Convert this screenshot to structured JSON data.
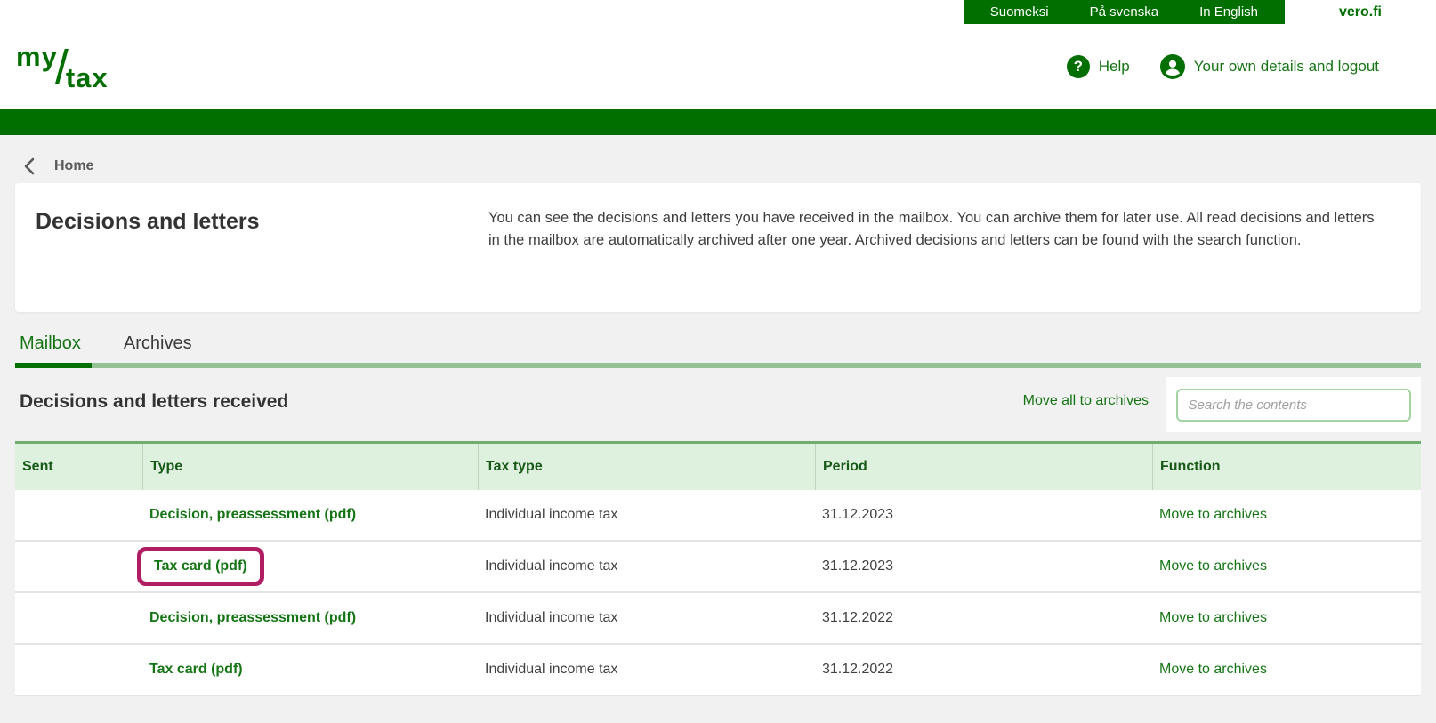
{
  "topbar": {
    "languages": [
      "Suomeksi",
      "På svenska",
      "In English"
    ],
    "site_link": "vero.fi"
  },
  "header": {
    "logo_my": "my",
    "logo_slash": "/",
    "logo_tax": "tax",
    "help_label": "Help",
    "help_glyph": "?",
    "account_label": "Your own details and logout"
  },
  "breadcrumb": {
    "back_label": "Home"
  },
  "intro": {
    "title": "Decisions and letters",
    "description": "You can see the decisions and letters you have received in the mailbox. You can archive them for later use. All read decisions and letters in the mailbox are automatically archived after one year. Archived decisions and letters can be found with the search function."
  },
  "tabs": [
    {
      "label": "Mailbox",
      "active": true
    },
    {
      "label": "Archives",
      "active": false
    }
  ],
  "received": {
    "title": "Decisions and letters received",
    "move_all_label": "Move all to archives",
    "search_placeholder": "Search the contents"
  },
  "table": {
    "columns": [
      "Sent",
      "Type",
      "Tax type",
      "Period",
      "Function"
    ],
    "rows": [
      {
        "sent": "",
        "type": "Decision, preassessment (pdf)",
        "tax_type": "Individual income tax",
        "period": "31.12.2023",
        "function": "Move to archives",
        "highlighted": false
      },
      {
        "sent": "",
        "type": "Tax card (pdf)",
        "tax_type": "Individual income tax",
        "period": "31.12.2023",
        "function": "Move to archives",
        "highlighted": true
      },
      {
        "sent": "",
        "type": "Decision, preassessment (pdf)",
        "tax_type": "Individual income tax",
        "period": "31.12.2022",
        "function": "Move to archives",
        "highlighted": false
      },
      {
        "sent": "",
        "type": "Tax card (pdf)",
        "tax_type": "Individual income tax",
        "period": "31.12.2022",
        "function": "Move to archives",
        "highlighted": false
      }
    ]
  },
  "colors": {
    "brand_green": "#006F00",
    "link_green": "#157515",
    "table_header_bg": "#def0de",
    "highlight_annotation": "#b01d63",
    "page_background": "#f1f1f1"
  }
}
